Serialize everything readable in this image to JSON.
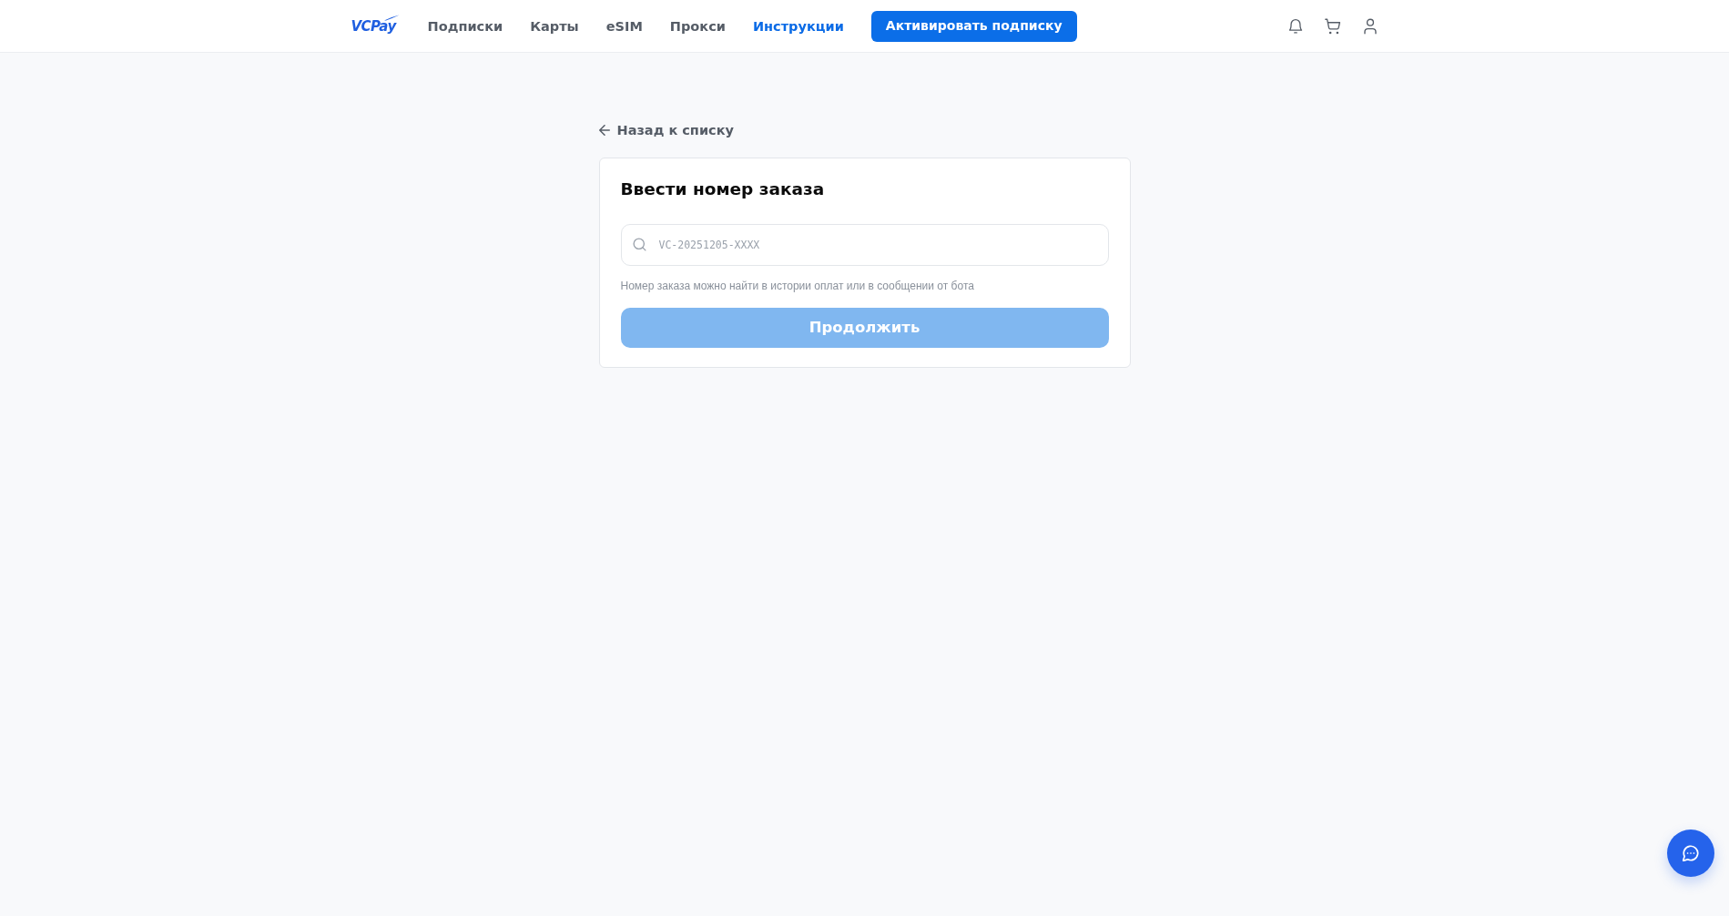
{
  "header": {
    "logo": "VCPay",
    "nav": [
      {
        "label": "Подписки",
        "selected": false
      },
      {
        "label": "Карты",
        "selected": false
      },
      {
        "label": "eSIM",
        "selected": false
      },
      {
        "label": "Прокси",
        "selected": false
      },
      {
        "label": "Инструкции",
        "selected": true
      }
    ],
    "cta_button": "Активировать подписку"
  },
  "back_link": "Назад к списку",
  "order_card": {
    "title": "Ввести номер заказа",
    "order_field": {
      "placeholder": "VC-20251205-XXXX"
    },
    "hint": "Номер заказа можно найти в истории оплат или в сообщении от бота",
    "submit_button": {
      "label": "Продолжить",
      "disabled": true
    }
  }
}
